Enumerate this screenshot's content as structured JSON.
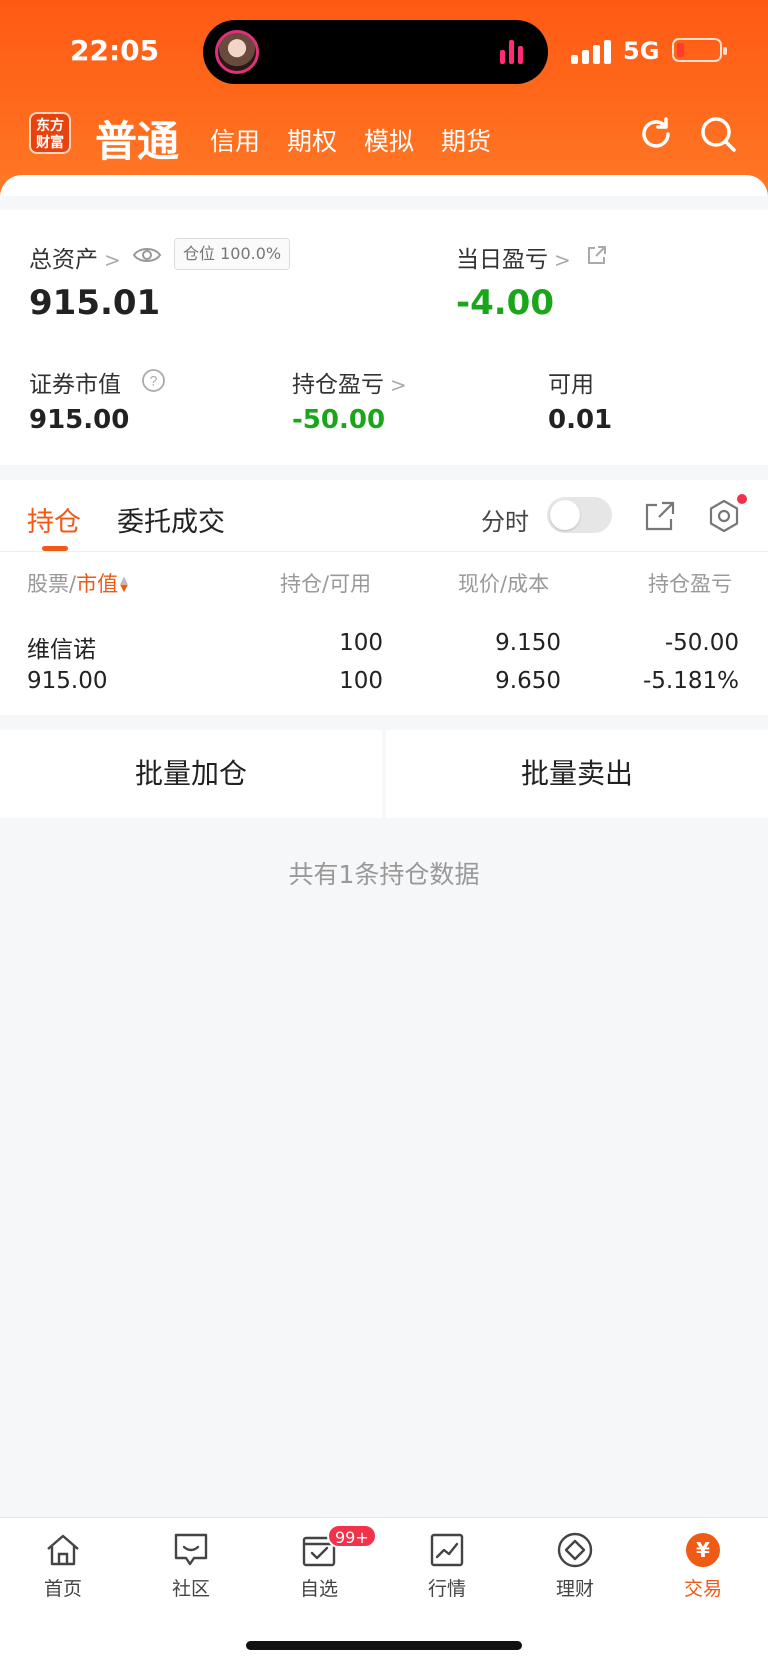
{
  "status_bar": {
    "time": "22:05",
    "network": "5G"
  },
  "header": {
    "logo_line1": "东方",
    "logo_line2": "财富",
    "active_tab": "普通",
    "tabs": [
      "信用",
      "期权",
      "模拟",
      "期货"
    ]
  },
  "assets": {
    "total_label": "总资产",
    "total_value": "915.01",
    "position_ratio": "仓位 100.0%",
    "daily_pl_label": "当日盈亏",
    "daily_pl_value": "-4.00",
    "market_value_label": "证券市值",
    "market_value": "915.00",
    "holding_pl_label": "持仓盈亏",
    "holding_pl_value": "-50.00",
    "available_label": "可用",
    "available_value": "0.01"
  },
  "holdings": {
    "tabs": [
      "持仓",
      "委托成交"
    ],
    "timeshare_label": "分时",
    "columns": {
      "stock": "股票",
      "sep": "/",
      "market_value": "市值",
      "position_available": "持仓/可用",
      "price_cost": "现价/成本",
      "holding_pl": "持仓盈亏"
    },
    "rows": [
      {
        "name": "维信诺",
        "market_value": "915.00",
        "position": "100",
        "available": "100",
        "price": "9.150",
        "cost": "9.650",
        "pl": "-50.00",
        "pl_pct": "-5.181%"
      }
    ]
  },
  "batch": {
    "add": "批量加仓",
    "sell": "批量卖出"
  },
  "summary": "共有1条持仓数据",
  "bottom_nav": {
    "items": [
      "首页",
      "社区",
      "自选",
      "行情",
      "理财",
      "交易"
    ],
    "watch_badge": "99+",
    "trade_symbol": "¥"
  },
  "colors": {
    "accent": "#ef5a16",
    "loss": "#1aa51a",
    "header": "#ff6a1c"
  }
}
